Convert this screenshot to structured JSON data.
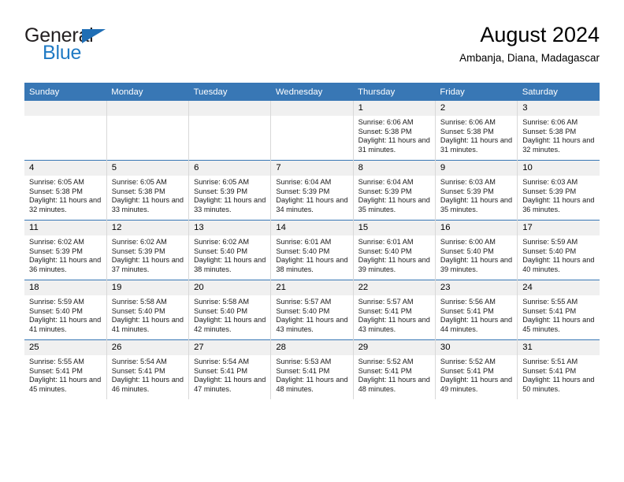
{
  "brand": {
    "name_part1": "General",
    "name_part2": "Blue",
    "flag_icon": "triangle-flag-icon"
  },
  "header": {
    "title": "August 2024",
    "location": "Ambanja, Diana, Madagascar"
  },
  "colors": {
    "header_blue": "#3877b5",
    "brand_blue": "#1f7ac4",
    "daynum_bg": "#f0f0f0",
    "cell_border": "#d8d8d8"
  },
  "weekday_headers": [
    "Sunday",
    "Monday",
    "Tuesday",
    "Wednesday",
    "Thursday",
    "Friday",
    "Saturday"
  ],
  "labels": {
    "sunrise_prefix": "Sunrise:",
    "sunset_prefix": "Sunset:",
    "daylight_prefix": "Daylight:"
  },
  "weeks": [
    [
      {
        "day": "",
        "empty": true
      },
      {
        "day": "",
        "empty": true
      },
      {
        "day": "",
        "empty": true
      },
      {
        "day": "",
        "empty": true
      },
      {
        "day": "1",
        "sunrise": "Sunrise: 6:06 AM",
        "sunset": "Sunset: 5:38 PM",
        "daylight": "Daylight: 11 hours and 31 minutes."
      },
      {
        "day": "2",
        "sunrise": "Sunrise: 6:06 AM",
        "sunset": "Sunset: 5:38 PM",
        "daylight": "Daylight: 11 hours and 31 minutes."
      },
      {
        "day": "3",
        "sunrise": "Sunrise: 6:06 AM",
        "sunset": "Sunset: 5:38 PM",
        "daylight": "Daylight: 11 hours and 32 minutes."
      }
    ],
    [
      {
        "day": "4",
        "sunrise": "Sunrise: 6:05 AM",
        "sunset": "Sunset: 5:38 PM",
        "daylight": "Daylight: 11 hours and 32 minutes."
      },
      {
        "day": "5",
        "sunrise": "Sunrise: 6:05 AM",
        "sunset": "Sunset: 5:38 PM",
        "daylight": "Daylight: 11 hours and 33 minutes."
      },
      {
        "day": "6",
        "sunrise": "Sunrise: 6:05 AM",
        "sunset": "Sunset: 5:39 PM",
        "daylight": "Daylight: 11 hours and 33 minutes."
      },
      {
        "day": "7",
        "sunrise": "Sunrise: 6:04 AM",
        "sunset": "Sunset: 5:39 PM",
        "daylight": "Daylight: 11 hours and 34 minutes."
      },
      {
        "day": "8",
        "sunrise": "Sunrise: 6:04 AM",
        "sunset": "Sunset: 5:39 PM",
        "daylight": "Daylight: 11 hours and 35 minutes."
      },
      {
        "day": "9",
        "sunrise": "Sunrise: 6:03 AM",
        "sunset": "Sunset: 5:39 PM",
        "daylight": "Daylight: 11 hours and 35 minutes."
      },
      {
        "day": "10",
        "sunrise": "Sunrise: 6:03 AM",
        "sunset": "Sunset: 5:39 PM",
        "daylight": "Daylight: 11 hours and 36 minutes."
      }
    ],
    [
      {
        "day": "11",
        "sunrise": "Sunrise: 6:02 AM",
        "sunset": "Sunset: 5:39 PM",
        "daylight": "Daylight: 11 hours and 36 minutes."
      },
      {
        "day": "12",
        "sunrise": "Sunrise: 6:02 AM",
        "sunset": "Sunset: 5:39 PM",
        "daylight": "Daylight: 11 hours and 37 minutes."
      },
      {
        "day": "13",
        "sunrise": "Sunrise: 6:02 AM",
        "sunset": "Sunset: 5:40 PM",
        "daylight": "Daylight: 11 hours and 38 minutes."
      },
      {
        "day": "14",
        "sunrise": "Sunrise: 6:01 AM",
        "sunset": "Sunset: 5:40 PM",
        "daylight": "Daylight: 11 hours and 38 minutes."
      },
      {
        "day": "15",
        "sunrise": "Sunrise: 6:01 AM",
        "sunset": "Sunset: 5:40 PM",
        "daylight": "Daylight: 11 hours and 39 minutes."
      },
      {
        "day": "16",
        "sunrise": "Sunrise: 6:00 AM",
        "sunset": "Sunset: 5:40 PM",
        "daylight": "Daylight: 11 hours and 39 minutes."
      },
      {
        "day": "17",
        "sunrise": "Sunrise: 5:59 AM",
        "sunset": "Sunset: 5:40 PM",
        "daylight": "Daylight: 11 hours and 40 minutes."
      }
    ],
    [
      {
        "day": "18",
        "sunrise": "Sunrise: 5:59 AM",
        "sunset": "Sunset: 5:40 PM",
        "daylight": "Daylight: 11 hours and 41 minutes."
      },
      {
        "day": "19",
        "sunrise": "Sunrise: 5:58 AM",
        "sunset": "Sunset: 5:40 PM",
        "daylight": "Daylight: 11 hours and 41 minutes."
      },
      {
        "day": "20",
        "sunrise": "Sunrise: 5:58 AM",
        "sunset": "Sunset: 5:40 PM",
        "daylight": "Daylight: 11 hours and 42 minutes."
      },
      {
        "day": "21",
        "sunrise": "Sunrise: 5:57 AM",
        "sunset": "Sunset: 5:40 PM",
        "daylight": "Daylight: 11 hours and 43 minutes."
      },
      {
        "day": "22",
        "sunrise": "Sunrise: 5:57 AM",
        "sunset": "Sunset: 5:41 PM",
        "daylight": "Daylight: 11 hours and 43 minutes."
      },
      {
        "day": "23",
        "sunrise": "Sunrise: 5:56 AM",
        "sunset": "Sunset: 5:41 PM",
        "daylight": "Daylight: 11 hours and 44 minutes."
      },
      {
        "day": "24",
        "sunrise": "Sunrise: 5:55 AM",
        "sunset": "Sunset: 5:41 PM",
        "daylight": "Daylight: 11 hours and 45 minutes."
      }
    ],
    [
      {
        "day": "25",
        "sunrise": "Sunrise: 5:55 AM",
        "sunset": "Sunset: 5:41 PM",
        "daylight": "Daylight: 11 hours and 45 minutes."
      },
      {
        "day": "26",
        "sunrise": "Sunrise: 5:54 AM",
        "sunset": "Sunset: 5:41 PM",
        "daylight": "Daylight: 11 hours and 46 minutes."
      },
      {
        "day": "27",
        "sunrise": "Sunrise: 5:54 AM",
        "sunset": "Sunset: 5:41 PM",
        "daylight": "Daylight: 11 hours and 47 minutes."
      },
      {
        "day": "28",
        "sunrise": "Sunrise: 5:53 AM",
        "sunset": "Sunset: 5:41 PM",
        "daylight": "Daylight: 11 hours and 48 minutes."
      },
      {
        "day": "29",
        "sunrise": "Sunrise: 5:52 AM",
        "sunset": "Sunset: 5:41 PM",
        "daylight": "Daylight: 11 hours and 48 minutes."
      },
      {
        "day": "30",
        "sunrise": "Sunrise: 5:52 AM",
        "sunset": "Sunset: 5:41 PM",
        "daylight": "Daylight: 11 hours and 49 minutes."
      },
      {
        "day": "31",
        "sunrise": "Sunrise: 5:51 AM",
        "sunset": "Sunset: 5:41 PM",
        "daylight": "Daylight: 11 hours and 50 minutes."
      }
    ]
  ]
}
